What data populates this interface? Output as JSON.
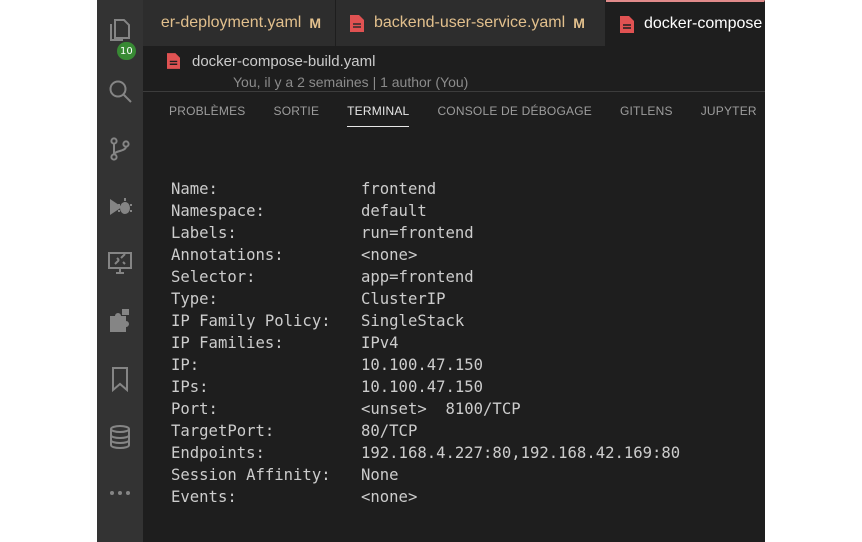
{
  "activity_bar": {
    "items": [
      {
        "icon": "explorer-icon",
        "badge": "10"
      },
      {
        "icon": "search-icon"
      },
      {
        "icon": "source-control-icon"
      },
      {
        "icon": "run-debug-icon"
      },
      {
        "icon": "remote-explorer-icon"
      },
      {
        "icon": "extensions-icon"
      },
      {
        "icon": "bookmarks-icon"
      },
      {
        "icon": "database-icon"
      },
      {
        "icon": "more-icon"
      }
    ]
  },
  "editor_tabs": [
    {
      "label": "er-deployment.yaml",
      "status": "M",
      "active": false
    },
    {
      "label": "backend-user-service.yaml",
      "status": "M",
      "active": false
    },
    {
      "label": "docker-compose",
      "status": "",
      "active": true
    }
  ],
  "breadcrumb": {
    "file": "docker-compose-build.yaml",
    "blame": "You, il y a 2 semaines | 1 author (You)"
  },
  "panel": {
    "tabs": [
      {
        "label": "PROBLÈMES",
        "active": false
      },
      {
        "label": "SORTIE",
        "active": false
      },
      {
        "label": "TERMINAL",
        "active": true
      },
      {
        "label": "CONSOLE DE DÉBOGAGE",
        "active": false
      },
      {
        "label": "GITLENS",
        "active": false
      },
      {
        "label": "JUPYTER",
        "active": false
      }
    ]
  },
  "terminal": {
    "rows": [
      {
        "key": "Name:",
        "value": "frontend"
      },
      {
        "key": "Namespace:",
        "value": "default"
      },
      {
        "key": "Labels:",
        "value": "run=frontend"
      },
      {
        "key": "Annotations:",
        "value": "<none>"
      },
      {
        "key": "Selector:",
        "value": "app=frontend"
      },
      {
        "key": "Type:",
        "value": "ClusterIP"
      },
      {
        "key": "IP Family Policy:",
        "value": "SingleStack"
      },
      {
        "key": "IP Families:",
        "value": "IPv4"
      },
      {
        "key": "IP:",
        "value": "10.100.47.150"
      },
      {
        "key": "IPs:",
        "value": "10.100.47.150"
      },
      {
        "key": "Port:",
        "value": "<unset>  8100/TCP"
      },
      {
        "key": "TargetPort:",
        "value": "80/TCP"
      },
      {
        "key": "Endpoints:",
        "value": "192.168.4.227:80,192.168.42.169:80"
      },
      {
        "key": "Session Affinity:",
        "value": "None"
      },
      {
        "key": "Events:",
        "value": "<none>"
      }
    ]
  },
  "colors": {
    "activity_bar_bg": "#333333",
    "editor_bg": "#1e1e1e",
    "modified_text": "#e2c08d",
    "yaml_icon": "#e05252",
    "badge": "#388a34"
  }
}
